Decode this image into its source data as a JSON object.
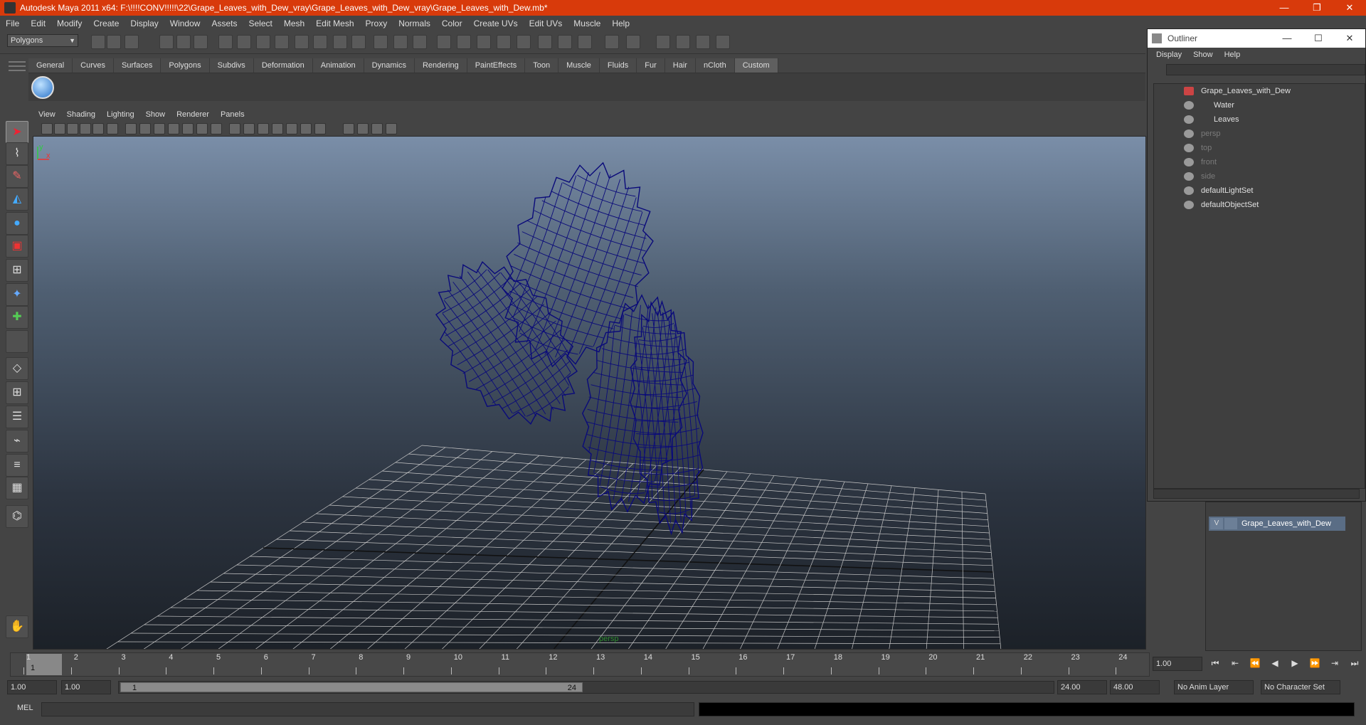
{
  "window": {
    "title": "Autodesk Maya 2011 x64: F:\\!!!!CONV!!!!!\\22\\Grape_Leaves_with_Dew_vray\\Grape_Leaves_with_Dew_vray\\Grape_Leaves_with_Dew.mb*",
    "minimize": "—",
    "restore": "❐",
    "close": "✕"
  },
  "menubar": [
    "File",
    "Edit",
    "Modify",
    "Create",
    "Display",
    "Window",
    "Assets",
    "Select",
    "Mesh",
    "Edit Mesh",
    "Proxy",
    "Normals",
    "Color",
    "Create UVs",
    "Edit UVs",
    "Muscle",
    "Help"
  ],
  "statusline": {
    "mode": "Polygons"
  },
  "shelf": {
    "tabs": [
      "General",
      "Curves",
      "Surfaces",
      "Polygons",
      "Subdivs",
      "Deformation",
      "Animation",
      "Dynamics",
      "Rendering",
      "PaintEffects",
      "Toon",
      "Muscle",
      "Fluids",
      "Fur",
      "Hair",
      "nCloth",
      "Custom"
    ],
    "active": "Custom"
  },
  "viewport": {
    "menu": [
      "View",
      "Shading",
      "Lighting",
      "Show",
      "Renderer",
      "Panels"
    ],
    "camera": "persp",
    "axis_y": "y",
    "axis_x": "x"
  },
  "outliner": {
    "title": "Outliner",
    "menu": [
      "Display",
      "Show",
      "Help"
    ],
    "filter_value": "",
    "items": [
      {
        "label": "Grape_Leaves_with_Dew",
        "depth": 0,
        "dim": false,
        "icon": "transform-icon"
      },
      {
        "label": "Water",
        "depth": 1,
        "dim": false,
        "icon": "mesh-icon"
      },
      {
        "label": "Leaves",
        "depth": 1,
        "dim": false,
        "icon": "mesh-icon"
      },
      {
        "label": "persp",
        "depth": 0,
        "dim": true,
        "icon": "camera-icon"
      },
      {
        "label": "top",
        "depth": 0,
        "dim": true,
        "icon": "camera-icon"
      },
      {
        "label": "front",
        "depth": 0,
        "dim": true,
        "icon": "camera-icon"
      },
      {
        "label": "side",
        "depth": 0,
        "dim": true,
        "icon": "camera-icon"
      },
      {
        "label": "defaultLightSet",
        "depth": 0,
        "dim": false,
        "icon": "set-icon"
      },
      {
        "label": "defaultObjectSet",
        "depth": 0,
        "dim": false,
        "icon": "set-icon"
      }
    ]
  },
  "layers": {
    "row": {
      "visible": "V",
      "name": "Grape_Leaves_with_Dew"
    }
  },
  "timeslider": {
    "current_frame": "1",
    "ticks": [
      "1",
      "2",
      "3",
      "4",
      "5",
      "6",
      "7",
      "8",
      "9",
      "10",
      "11",
      "12",
      "13",
      "14",
      "15",
      "16",
      "17",
      "18",
      "19",
      "20",
      "21",
      "22",
      "23",
      "24"
    ],
    "current_time_field": "1.00"
  },
  "range": {
    "start_time": "1.00",
    "playback_start": "1.00",
    "range_start_label": "1",
    "range_end_label": "24",
    "playback_end": "24.00",
    "end_time": "48.00",
    "anim_layer": "No Anim Layer",
    "character_set": "No Character Set"
  },
  "playback": [
    "⏮",
    "⇤",
    "⏪",
    "◀",
    "▶",
    "⏩",
    "⇥",
    "⏭"
  ],
  "command": {
    "label": "MEL"
  },
  "colors": {
    "titlebar": "#d83a0b",
    "wireframe": "#0a0a7a",
    "grid": "#c8c8c8",
    "layer_row": "#5a6d85"
  }
}
